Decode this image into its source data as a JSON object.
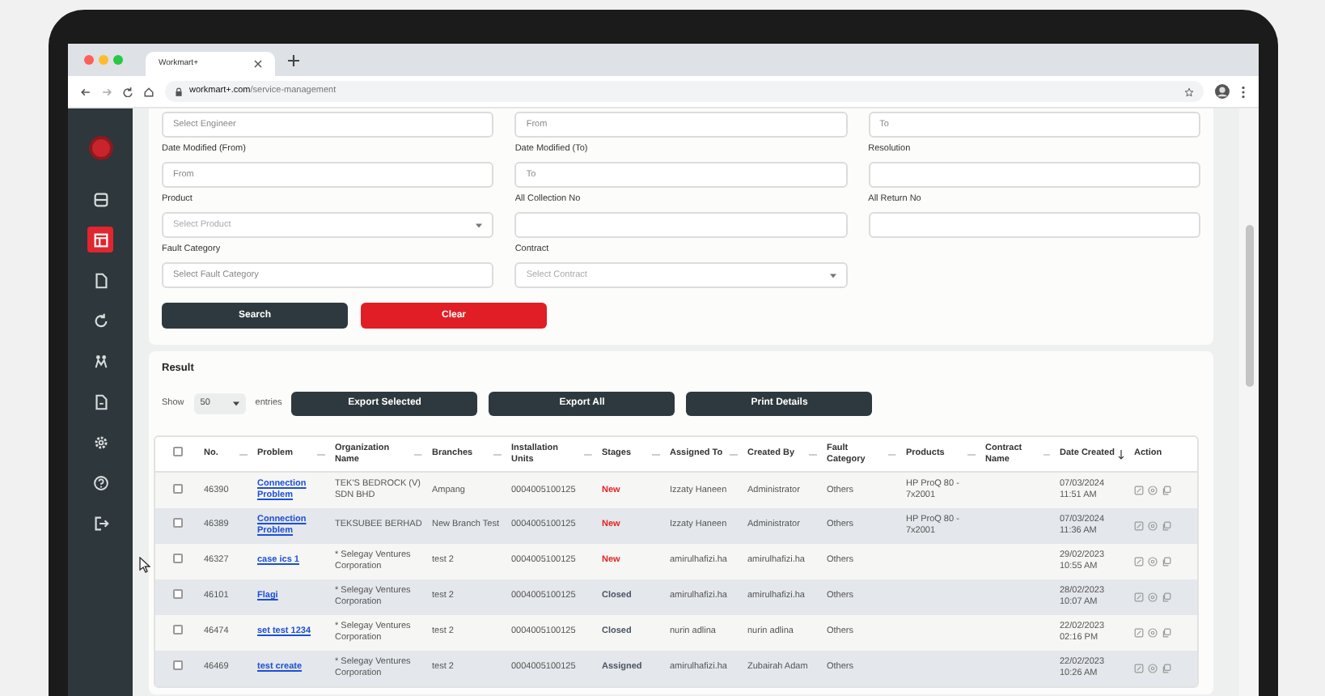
{
  "browser": {
    "tab_title": "Workmart+",
    "url_domain": "workmart+.com",
    "url_path": "/service-management"
  },
  "sidebar": {
    "items": [
      {
        "selected": false
      },
      {
        "selected": true
      },
      {
        "selected": false
      },
      {
        "selected": false
      },
      {
        "selected": false
      },
      {
        "selected": false
      },
      {
        "selected": false
      },
      {
        "selected": false
      },
      {
        "selected": false
      }
    ]
  },
  "filters": [
    [
      {
        "placeholder": "Select Engineer",
        "kind": "input"
      },
      {
        "placeholder": "From",
        "kind": "input"
      },
      {
        "placeholder": "To",
        "kind": "input"
      }
    ],
    [
      {
        "label": "Date Modified (From)",
        "placeholder": "From",
        "kind": "input"
      },
      {
        "label": "Date Modified (To)",
        "placeholder": "To",
        "kind": "input"
      },
      {
        "label": "Resolution",
        "kind": "input"
      }
    ],
    [
      {
        "label": "Product",
        "placeholder": "Select Product",
        "kind": "select"
      },
      {
        "label": "All Collection No",
        "kind": "input"
      },
      {
        "label": "All Return No",
        "kind": "input"
      }
    ],
    [
      {
        "label": "Fault Category",
        "placeholder": "Select Fault Category",
        "kind": "input"
      },
      {
        "label": "Contract",
        "placeholder": "Select Contract",
        "kind": "select"
      }
    ]
  ],
  "filter_buttons": [
    {
      "label": "Search",
      "kind": "primary"
    },
    {
      "label": "Clear",
      "kind": "danger"
    }
  ],
  "result": {
    "title": "Result",
    "show_label": "Show",
    "page_size": "50",
    "entries_label": "entries",
    "buttons": [
      "Export Selected",
      "Export All",
      "Print Details"
    ]
  },
  "table": {
    "select_all_checked": false,
    "columns": [
      {
        "label": "No.",
        "sorted": false
      },
      {
        "label": "Problem",
        "sorted": false
      },
      {
        "label": "Organization Name",
        "sorted": false
      },
      {
        "label": "Branches",
        "sorted": false
      },
      {
        "label": "Installation Units",
        "sorted": false
      },
      {
        "label": "Stages",
        "sorted": false
      },
      {
        "label": "Assigned To",
        "sorted": false
      },
      {
        "label": "Created By",
        "sorted": false
      },
      {
        "label": "Fault Category",
        "sorted": false
      },
      {
        "label": "Products",
        "sorted": false
      },
      {
        "label": "Contract Name",
        "sorted": false
      },
      {
        "label": "Date Created",
        "sorted": true
      },
      {
        "label": "Action"
      }
    ],
    "rows": [
      {
        "checked": false,
        "no": "46390",
        "problem": "Connection Problem",
        "organization": "TEK'S BEDROCK (V) SDN BHD",
        "branch": "Ampang",
        "installation_units": "0004005100125",
        "stage": "New",
        "color": "#e02424",
        "assigned_to": "Izzaty Haneen",
        "created_by": "Administrator",
        "fault_category": "Others",
        "products": "HP ProQ 80 - 7x2001",
        "date_created": "07/03/2024 11:51 AM"
      },
      {
        "checked": false,
        "no": "46389",
        "problem": "Connection Problem",
        "organization": "TEKSUBEE BERHAD",
        "branch": "New Branch Test",
        "installation_units": "0004005100125",
        "stage": "New",
        "color": "#e02424",
        "assigned_to": "Izzaty Haneen",
        "created_by": "Administrator",
        "fault_category": "Others",
        "products": "HP ProQ 80 - 7x2001",
        "date_created": "07/03/2024 11:36 AM"
      },
      {
        "checked": false,
        "no": "46327",
        "problem": "case ics 1",
        "organization": "* Selegay Ventures Corporation",
        "branch": "test 2",
        "installation_units": "0004005100125",
        "stage": "New",
        "color": "#e02424",
        "assigned_to": "amirulhafizi.ha",
        "created_by": "amirulhafizi.ha",
        "fault_category": "Others",
        "date_created": "29/02/2023 10:55 AM"
      },
      {
        "checked": false,
        "no": "46101",
        "problem": "Flagi",
        "organization": "* Selegay Ventures Corporation",
        "branch": "test 2",
        "installation_units": "0004005100125",
        "stage": "Closed",
        "color": "#4b5563",
        "assigned_to": "amirulhafizi.ha",
        "created_by": "amirulhafizi.ha",
        "fault_category": "Others",
        "date_created": "28/02/2023 10:07 AM"
      },
      {
        "checked": false,
        "no": "46474",
        "problem": "set test 1234",
        "organization": "* Selegay Ventures Corporation",
        "branch": "test 2",
        "installation_units": "0004005100125",
        "stage": "Closed",
        "color": "#4b5563",
        "assigned_to": "nurin adlina",
        "created_by": "nurin adlina",
        "fault_category": "Others",
        "date_created": "22/02/2023 02:16 PM"
      },
      {
        "checked": false,
        "no": "46469",
        "problem": "test create",
        "organization": "* Selegay Ventures Corporation",
        "branch": "test 2",
        "installation_units": "0004005100125",
        "stage": "Assigned",
        "color": "#4b5563",
        "assigned_to": "amirulhafizi.ha",
        "created_by": "Zubairah Adam",
        "fault_category": "Others",
        "date_created": "22/02/2023 10:26 AM"
      }
    ]
  }
}
